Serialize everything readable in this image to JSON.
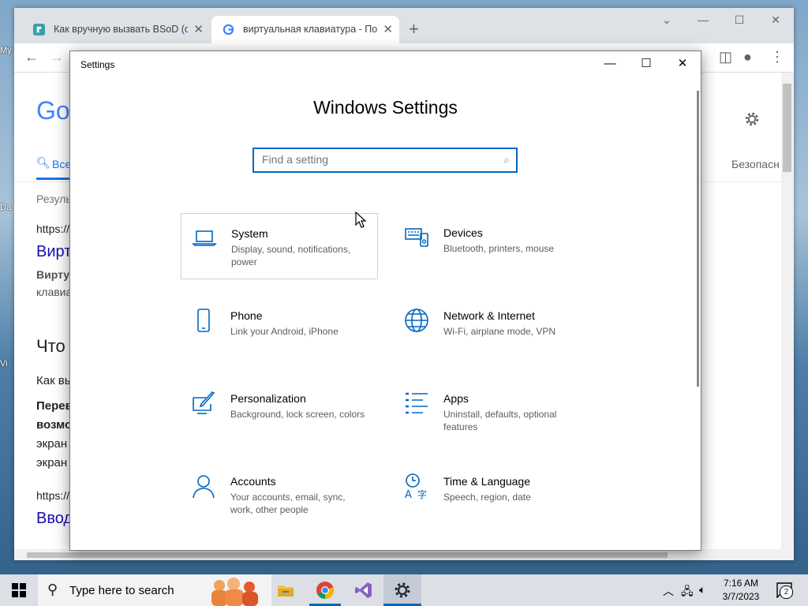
{
  "desktop": {
    "labels": [
      "My",
      "Da",
      "Vi"
    ]
  },
  "chrome": {
    "tabs": [
      {
        "title": "Как вручную вызвать BSoD (си...",
        "active": false
      },
      {
        "title": "виртуальная клавиатура - Поис...",
        "active": true
      }
    ],
    "new_tab": "+",
    "google": {
      "logo": "Go",
      "tab_all": "Все",
      "results_count": "Резуль",
      "right_link": "Безопасн",
      "lines": [
        "https://",
        "Вирт",
        "Вирту",
        "клавиа",
        "Что",
        "Как вы",
        "Перев",
        "возмо",
        "экран",
        "экран",
        "https://",
        "Ввод"
      ]
    }
  },
  "settings": {
    "window_title": "Settings",
    "heading": "Windows Settings",
    "search_placeholder": "Find a setting",
    "tiles": [
      {
        "title": "System",
        "desc": "Display, sound, notifications, power",
        "icon": "laptop-icon"
      },
      {
        "title": "Devices",
        "desc": "Bluetooth, printers, mouse",
        "icon": "devices-icon"
      },
      {
        "title": "Phone",
        "desc": "Link your Android, iPhone",
        "icon": "phone-icon"
      },
      {
        "title": "Network & Internet",
        "desc": "Wi-Fi, airplane mode, VPN",
        "icon": "globe-icon"
      },
      {
        "title": "Personalization",
        "desc": "Background, lock screen, colors",
        "icon": "brush-icon"
      },
      {
        "title": "Apps",
        "desc": "Uninstall, defaults, optional features",
        "icon": "apps-list-icon"
      },
      {
        "title": "Accounts",
        "desc": "Your accounts, email, sync, work, other people",
        "icon": "person-icon"
      },
      {
        "title": "Time & Language",
        "desc": "Speech, region, date",
        "icon": "time-language-icon"
      }
    ]
  },
  "taskbar": {
    "search_placeholder": "Type here to search",
    "time": "7:16 AM",
    "date": "3/7/2023",
    "notification_count": "2"
  },
  "colors": {
    "accent": "#0067c0",
    "chrome_bg": "#dee1e6",
    "taskbar_bg": "#dcdfe6"
  }
}
